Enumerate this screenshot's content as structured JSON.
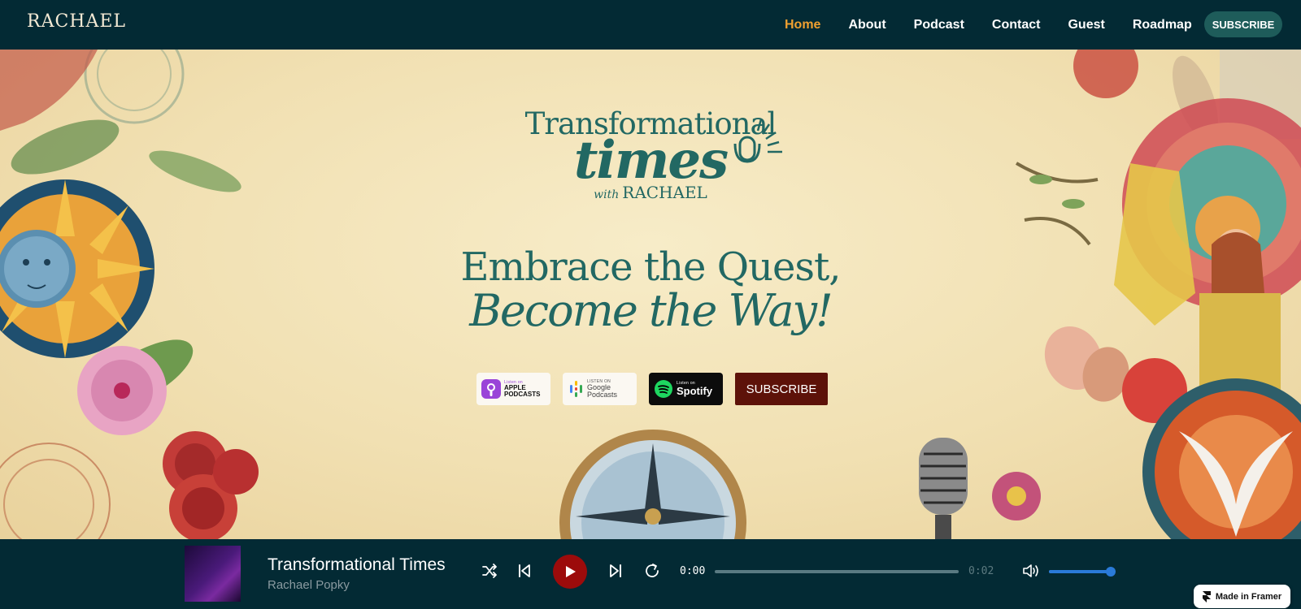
{
  "nav": {
    "logo": "RACHAEL",
    "links": [
      "Home",
      "About",
      "Podcast",
      "Contact",
      "Guest",
      "Roadmap"
    ],
    "active": "Home",
    "subscribe_label": "SUBSCRIBE"
  },
  "hero": {
    "brand_line1": "Transformational",
    "brand_line2": "times",
    "brand_with": "with",
    "brand_name": "RACHAEL",
    "tagline_line1": "Embrace the Quest,",
    "tagline_line2": "Become the Way!",
    "badges": {
      "apple": {
        "small": "Listen on",
        "big": "APPLE\nPODCASTS"
      },
      "google": {
        "small": "LISTEN ON",
        "big": "Google\nPodcasts"
      },
      "spotify": {
        "small": "Listen on",
        "big": "Spotify"
      }
    },
    "subscribe_label": "SUBSCRIBE"
  },
  "player": {
    "title": "Transformational Times",
    "artist": "Rachael Popky",
    "current_time": "0:00",
    "duration": "0:02",
    "progress_fraction": 0.0,
    "volume_fraction": 0.95,
    "icons": [
      "shuffle-icon",
      "previous-icon",
      "play-icon",
      "next-icon",
      "repeat-icon",
      "volume-icon"
    ]
  },
  "badge": {
    "made_in_framer": "Made in Framer"
  },
  "colors": {
    "nav_bg": "#032a34",
    "accent": "#f0a030",
    "brand_teal": "#226863",
    "play_red": "#9c0b0b",
    "subscribe_maroon": "#5d1209"
  }
}
